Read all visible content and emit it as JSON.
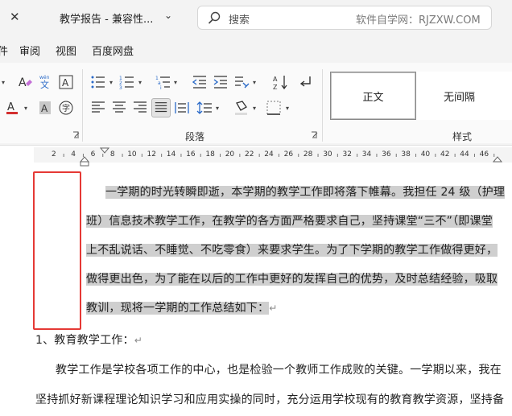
{
  "titlebar": {
    "title": "教学报告 - 兼容性...",
    "search_placeholder": "搜索",
    "watermark": "软件自学网：RJZXW.COM"
  },
  "menubar": {
    "items": [
      "件",
      "审阅",
      "视图",
      "百度网盘"
    ]
  },
  "ribbon": {
    "paragraph_label": "段落",
    "styles_label": "样式",
    "styles": [
      "正文",
      "无间隔"
    ],
    "phonetic_guide": "wén 文"
  },
  "ruler": {
    "numbers": [
      "2",
      "4",
      "6",
      "8",
      "10",
      "12",
      "14",
      "16",
      "18",
      "20",
      "22",
      "24",
      "26",
      "28",
      "30",
      "32",
      "34",
      "36",
      "38",
      "40",
      "42",
      "44",
      "46"
    ]
  },
  "document": {
    "para1_lines": [
      "一学期的时光转瞬即逝，本学期的教学工作即将落下帷幕。我担任 24 级（护理",
      "班）信息技术教学工作，在教学的各方面严格要求自己，坚持课堂“三不”（即课堂",
      "上不乱说话、不睡觉、不吃零食）来要求学生。为了下学期的教学工作做得更好，",
      "做得更出色，为了能在以后的工作中更好的发挥自己的优势，及时总结经验，吸取",
      "教训，现将一学期的工作总结如下："
    ],
    "heading1": "1、教育教学工作：",
    "para2_lines": [
      "教学工作是学校各项工作的中心，也是检验一个教师工作成败的关键。一学期以来，我在",
      "坚持抓好新课程理论知识学习和应用实操的同时，充分运用学校现有的教育教学资源，坚持备"
    ],
    "paragraph_mark": "↵"
  },
  "colors": {
    "selection": "#cfcfcf",
    "highlight_box": "#e53935",
    "spellcheck": "#e04040"
  }
}
